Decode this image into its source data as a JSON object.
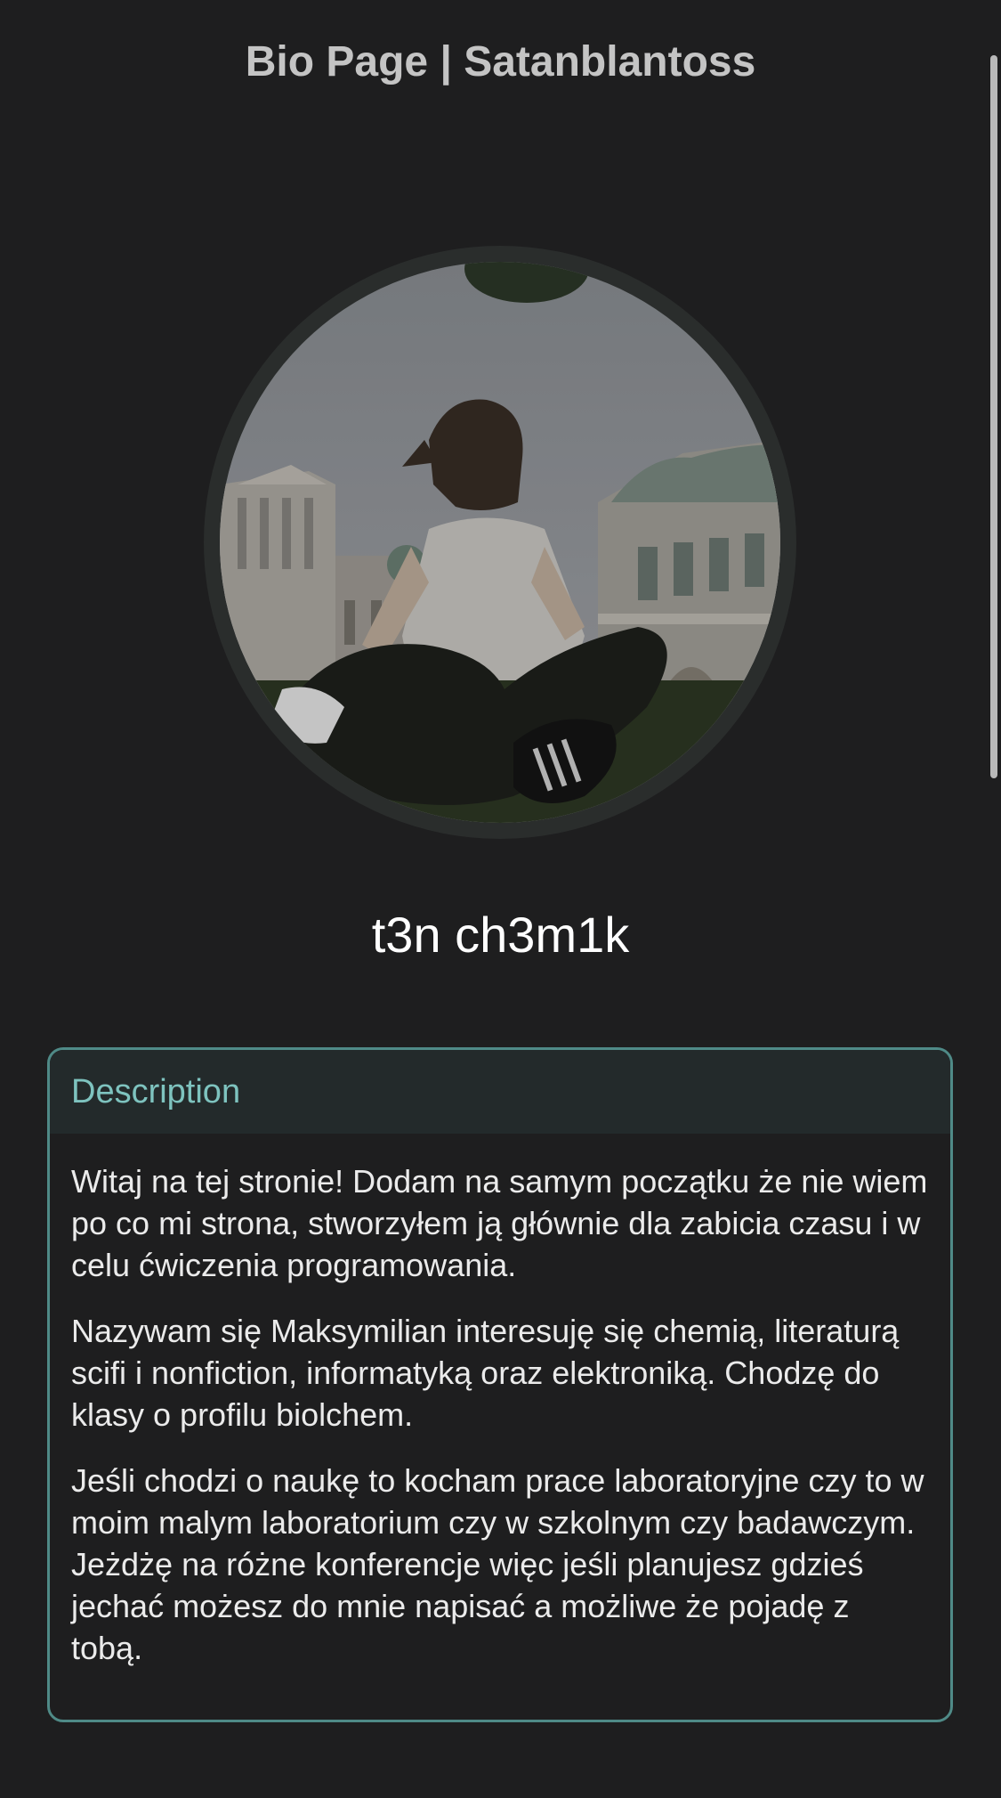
{
  "header": {
    "title": "Bio Page | Satanblantoss"
  },
  "profile": {
    "avatar_alt": "profile photo",
    "name": "t3n ch3m1k"
  },
  "description": {
    "title": "Description",
    "paragraphs": [
      "Witaj na tej stronie! Dodam na samym początku że nie wiem po co mi strona, stworzyłem ją głównie dla zabicia czasu i w celu ćwiczenia programowania.",
      "Nazywam się Maksymilian interesuję się chemią, literaturą scifi i nonfiction, informatyką oraz elektroniką. Chodzę do klasy o profilu biolchem.",
      "Jeśli chodzi o naukę to kocham prace laboratoryjne czy to w moim malym laboratorium czy w szkolnym czy badawczym. Jeżdżę na różne konferencje więc jeśli planujesz gdzieś jechać możesz do mnie napisać a możliwe że pojadę z tobą."
    ]
  },
  "colors": {
    "background": "#1e1e1f",
    "accent_border": "#4f8a87",
    "accent_text": "#7ec3bf",
    "title_text": "#c4c4c4"
  }
}
